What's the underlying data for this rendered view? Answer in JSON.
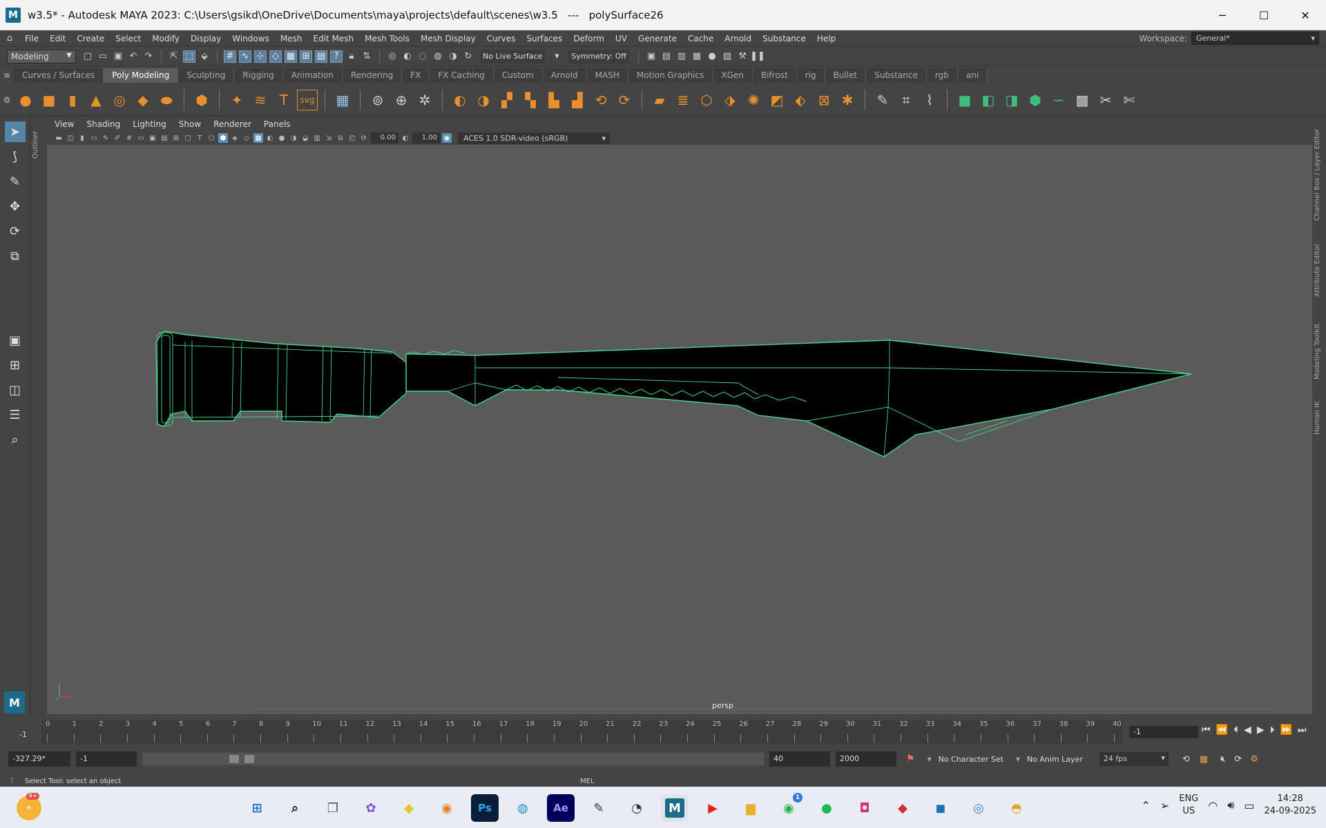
{
  "window": {
    "title": "w3.5* - Autodesk MAYA 2023: C:\\Users\\gsikd\\OneDrive\\Documents\\maya\\projects\\default\\scenes\\w3.5   ---   polySurface26",
    "minimize": "─",
    "maximize": "☐",
    "close": "✕",
    "app_icon": "M"
  },
  "menubar": {
    "items": [
      "File",
      "Edit",
      "Create",
      "Select",
      "Modify",
      "Display",
      "Windows",
      "Mesh",
      "Edit Mesh",
      "Mesh Tools",
      "Mesh Display",
      "Curves",
      "Surfaces",
      "Deform",
      "UV",
      "Generate",
      "Cache",
      "Arnold",
      "Substance",
      "Help"
    ],
    "workspace_label": "Workspace:",
    "workspace_value": "General*"
  },
  "statusline": {
    "mode": "Modeling",
    "live_surface": "No Live Surface",
    "symmetry": "Symmetry: Off"
  },
  "shelf": {
    "tabs": [
      "Curves / Surfaces",
      "Poly Modeling",
      "Sculpting",
      "Rigging",
      "Animation",
      "Rendering",
      "FX",
      "FX Caching",
      "Custom",
      "Arnold",
      "MASH",
      "Motion Graphics",
      "XGen",
      "Bifrost",
      "rig",
      "Bullet",
      "Substance",
      "rgb",
      "ani"
    ],
    "active_tab": "Poly Modeling",
    "text_icon": "T",
    "svg_icon": "svg"
  },
  "panel": {
    "menus": [
      "View",
      "Shading",
      "Lighting",
      "Show",
      "Renderer",
      "Panels"
    ],
    "exposure": "0.00",
    "gamma": "1.00",
    "colorspace": "ACES 1.0 SDR-video (sRGB)",
    "camera": "persp"
  },
  "right_tabs": [
    "Channel Box / Layer Editor",
    "Attribute Editor",
    "Modeling Toolkit",
    "Human IK"
  ],
  "outliner_tab": "Outliner",
  "timeslider": {
    "ticks": [
      "0",
      "1",
      "2",
      "3",
      "4",
      "5",
      "6",
      "7",
      "8",
      "9",
      "10",
      "11",
      "12",
      "13",
      "14",
      "15",
      "16",
      "17",
      "18",
      "19",
      "20",
      "21",
      "22",
      "23",
      "24",
      "25",
      "26",
      "27",
      "28",
      "29",
      "30",
      "31",
      "32",
      "33",
      "34",
      "35",
      "36",
      "37",
      "38",
      "39",
      "40"
    ],
    "current_frame": "-1",
    "current_frame_marker": "-1",
    "frame_field": "-1"
  },
  "rangeslider": {
    "start_field": "-327.29*",
    "start_frame": "-1",
    "end_frame": "40",
    "max_frame": "2000",
    "character_set": "No Character Set",
    "anim_layer": "No Anim Layer",
    "fps": "24 fps"
  },
  "helpline": {
    "text": "Select Tool: select an object",
    "mel_label": "MEL"
  },
  "taskbar": {
    "weather_badge": "9+",
    "whatsapp_badge": "1",
    "photoshop_label": "Ps",
    "aftereffects_label": "Ae",
    "maya_label": "M",
    "language": "ENG",
    "region": "US",
    "time": "14:28",
    "date": "24-09-2025"
  }
}
